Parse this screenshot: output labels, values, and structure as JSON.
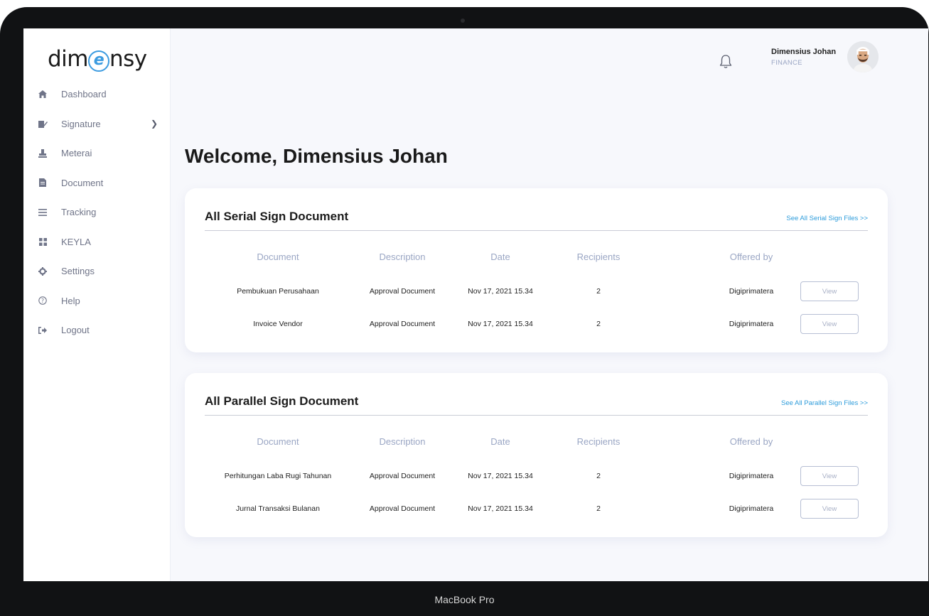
{
  "device": {
    "label": "MacBook Pro"
  },
  "brand": {
    "left": "dim",
    "mark": "e",
    "right": "nsy",
    "accent": "#3b9be0"
  },
  "sidebar": {
    "items": [
      {
        "label": "Dashboard",
        "icon": "home-icon"
      },
      {
        "label": "Signature",
        "icon": "signature-icon",
        "has_submenu": true
      },
      {
        "label": "Meterai",
        "icon": "stamp-icon"
      },
      {
        "label": "Document",
        "icon": "document-icon"
      },
      {
        "label": "Tracking",
        "icon": "list-icon"
      },
      {
        "label": "KEYLA",
        "icon": "grid-icon"
      },
      {
        "label": "Settings",
        "icon": "gear-icon"
      },
      {
        "label": "Help",
        "icon": "help-icon"
      },
      {
        "label": "Logout",
        "icon": "logout-icon"
      }
    ]
  },
  "header": {
    "user_name": "Dimensius Johan",
    "user_role": "FINANCE"
  },
  "main": {
    "welcome": "Welcome, Dimensius Johan",
    "columns": [
      "Document",
      "Description",
      "Date",
      "Recipients",
      "Offered by"
    ],
    "view_label": "View",
    "serial": {
      "title": "All Serial Sign Document",
      "link": "See All Serial Sign Files >>",
      "rows": [
        [
          "Pembukuan Perusahaan",
          "Approval Document",
          "Nov 17, 2021 15.34",
          "2",
          "Digiprimatera"
        ],
        [
          "Invoice Vendor",
          "Approval Document",
          "Nov 17, 2021 15.34",
          "2",
          "Digiprimatera"
        ]
      ]
    },
    "parallel": {
      "title": "All Parallel Sign Document",
      "link": "See All Parallel Sign Files >>",
      "rows": [
        [
          "Perhitungan Laba Rugi Tahunan",
          "Approval Document",
          "Nov 17, 2021 15.34",
          "2",
          "Digiprimatera"
        ],
        [
          "Jurnal Transaksi Bulanan",
          "Approval Document",
          "Nov 17, 2021 15.34",
          "2",
          "Digiprimatera"
        ]
      ]
    }
  }
}
